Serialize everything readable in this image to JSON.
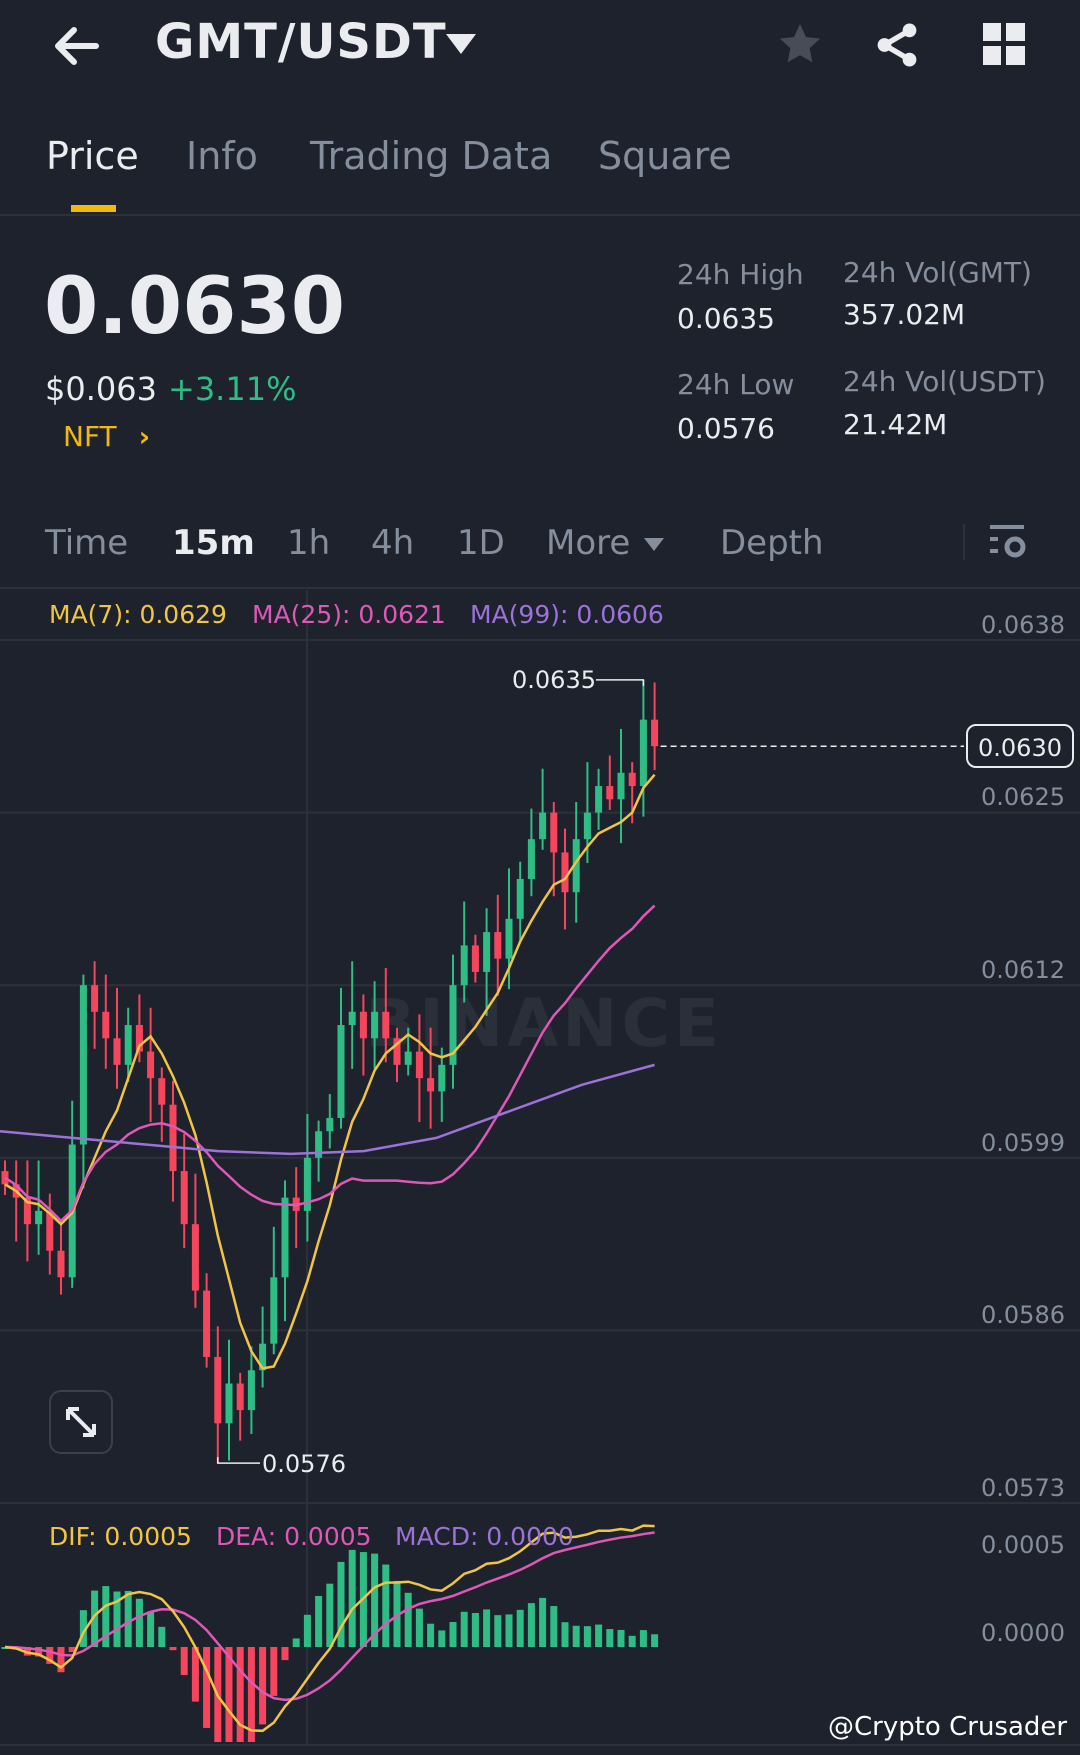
{
  "header": {
    "title": "GMT/USDT",
    "icons": [
      "back-arrow-icon",
      "dropdown-caret-icon",
      "star-icon",
      "share-icon",
      "grid-icon"
    ]
  },
  "tabs": [
    {
      "label": "Price",
      "active": true
    },
    {
      "label": "Info"
    },
    {
      "label": "Trading Data"
    },
    {
      "label": "Square"
    }
  ],
  "ticker": {
    "last_price": "0.0630",
    "usd_price": "$0.063",
    "change": "+3.11%",
    "tag": "NFT",
    "stats": [
      {
        "label": "24h High",
        "value": "0.0635"
      },
      {
        "label": "24h Vol(GMT)",
        "value": "357.02M"
      },
      {
        "label": "24h Low",
        "value": "0.0576"
      },
      {
        "label": "24h Vol(USDT)",
        "value": "21.42M"
      }
    ]
  },
  "timeframes": [
    "Time",
    "15m",
    "1h",
    "4h",
    "1D",
    "More",
    "Depth"
  ],
  "active_timeframe": "15m",
  "ma_legend": {
    "ma7": "MA(7): 0.0629",
    "ma25": "MA(25): 0.0621",
    "ma99": "MA(99): 0.0606"
  },
  "macd_legend": {
    "dif": "DIF: 0.0005",
    "dea": "DEA: 0.0005",
    "macd": "MACD: 0.0000"
  },
  "watermark": "BINANCE",
  "credit": "@Crypto Crusader",
  "colors": {
    "up": "#2ebd85",
    "down": "#f6465d",
    "ma7": "#f0c545",
    "ma25": "#de58b8",
    "ma99": "#9d72d8",
    "accent": "#f0b90b"
  },
  "chart_data": {
    "type": "candlestick",
    "price_axis": [
      "0.0638",
      "0.0625",
      "0.0612",
      "0.0599",
      "0.0586",
      "0.0573"
    ],
    "ylim": [
      0.0573,
      0.0638
    ],
    "current_price": "0.0630",
    "high_label": "0.0635",
    "low_label": "0.0576",
    "high": 0.0635,
    "high_index": 57,
    "low": 0.0576,
    "low_index": 19,
    "closes": [
      0.0597,
      0.0596,
      0.0594,
      0.0595,
      0.0592,
      0.059,
      0.06,
      0.0612,
      0.061,
      0.0608,
      0.0606,
      0.0609,
      0.0607,
      0.0605,
      0.0603,
      0.0598,
      0.0594,
      0.0589,
      0.0584,
      0.0579,
      0.0582,
      0.058,
      0.0583,
      0.0585,
      0.059,
      0.0596,
      0.0595,
      0.0599,
      0.0601,
      0.0602,
      0.0609,
      0.061,
      0.0608,
      0.061,
      0.0608,
      0.0606,
      0.0607,
      0.0605,
      0.0604,
      0.0606,
      0.0612,
      0.0615,
      0.0613,
      0.0616,
      0.0614,
      0.0617,
      0.062,
      0.0623,
      0.0625,
      0.0622,
      0.0619,
      0.0623,
      0.0625,
      0.0627,
      0.0626,
      0.0628,
      0.0627,
      0.0632,
      0.063
    ],
    "ma99": [
      0.0601,
      0.06005,
      0.06,
      0.05995,
      0.05993,
      0.05995,
      0.06005,
      0.06025,
      0.06045,
      0.0606
    ],
    "macd_axis": [
      "0.0005",
      "0.0000"
    ]
  }
}
